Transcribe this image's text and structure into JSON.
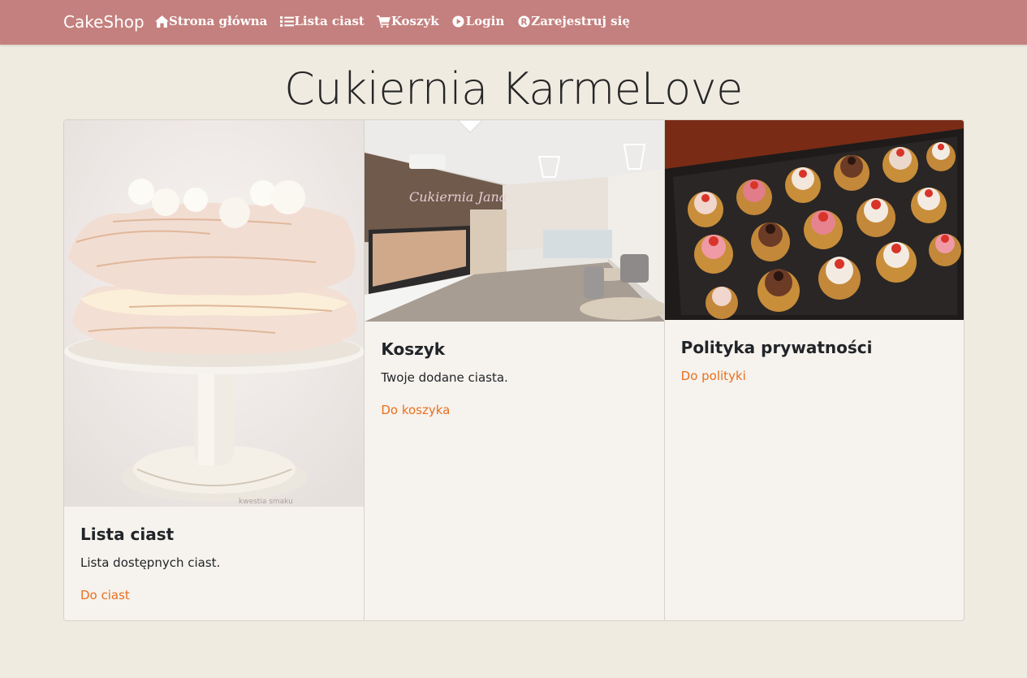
{
  "navbar": {
    "brand": "CakeShop",
    "items": [
      {
        "label": "Strona główna",
        "icon": "home-icon"
      },
      {
        "label": "Lista ciast",
        "icon": "list-icon"
      },
      {
        "label": "Koszyk",
        "icon": "cart-icon"
      },
      {
        "label": "Login",
        "icon": "login-icon"
      },
      {
        "label": "Zarejestruj się",
        "icon": "register-icon"
      }
    ]
  },
  "page": {
    "title": "Cukiernia KarmeLove"
  },
  "cards": [
    {
      "title": "Lista ciast",
      "text": "Lista dostępnych ciast.",
      "link": "Do ciast",
      "image_caption": "kwestia smaku"
    },
    {
      "title": "Koszyk",
      "text": "Twoje dodane ciasta.",
      "link": "Do koszyka",
      "image_sign": "Cukiernia Jana"
    },
    {
      "title": "Polityka prywatności",
      "text": "",
      "link": "Do polityki"
    }
  ],
  "colors": {
    "navbar": "#c4807e",
    "background": "#efebe1",
    "card": "#f6f2ed",
    "link": "#e8701f"
  }
}
